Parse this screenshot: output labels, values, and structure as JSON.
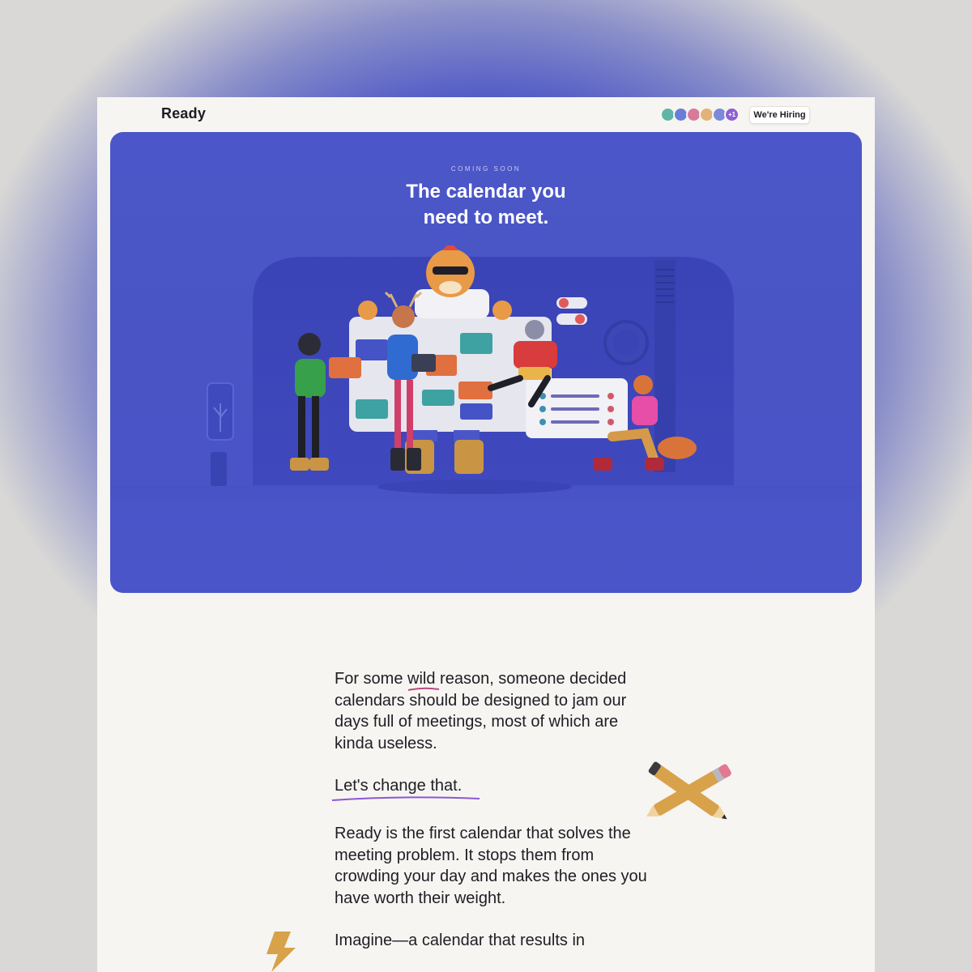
{
  "app": {
    "brand": "Ready",
    "hiring_button": "We're Hiring",
    "team_extra_count": "+1"
  },
  "hero": {
    "eyebrow": "COMING SOON",
    "title_line1": "The calendar you",
    "title_line2": "need to meet."
  },
  "body": {
    "para1_before": "For some ",
    "para1_highlight": "wild",
    "para1_after": " reason, someone decided calendars should be designed to jam our days full of meetings, most of which are kinda useless.",
    "cta": "Let's change that.",
    "para2": "Ready is the first calendar that solves the meeting problem. It stops them from crowding your day and makes the ones you have worth their weight.",
    "para3": "Imagine—a calendar that results in"
  },
  "colors": {
    "hero_bg": "#4b57c8",
    "page_bg": "#f7f5f2",
    "text": "#1e1e24",
    "accent_underline": "#8a58d6"
  },
  "icons": [
    "team-avatar-icon",
    "pencils-icon",
    "lightning-bolt-icon"
  ]
}
